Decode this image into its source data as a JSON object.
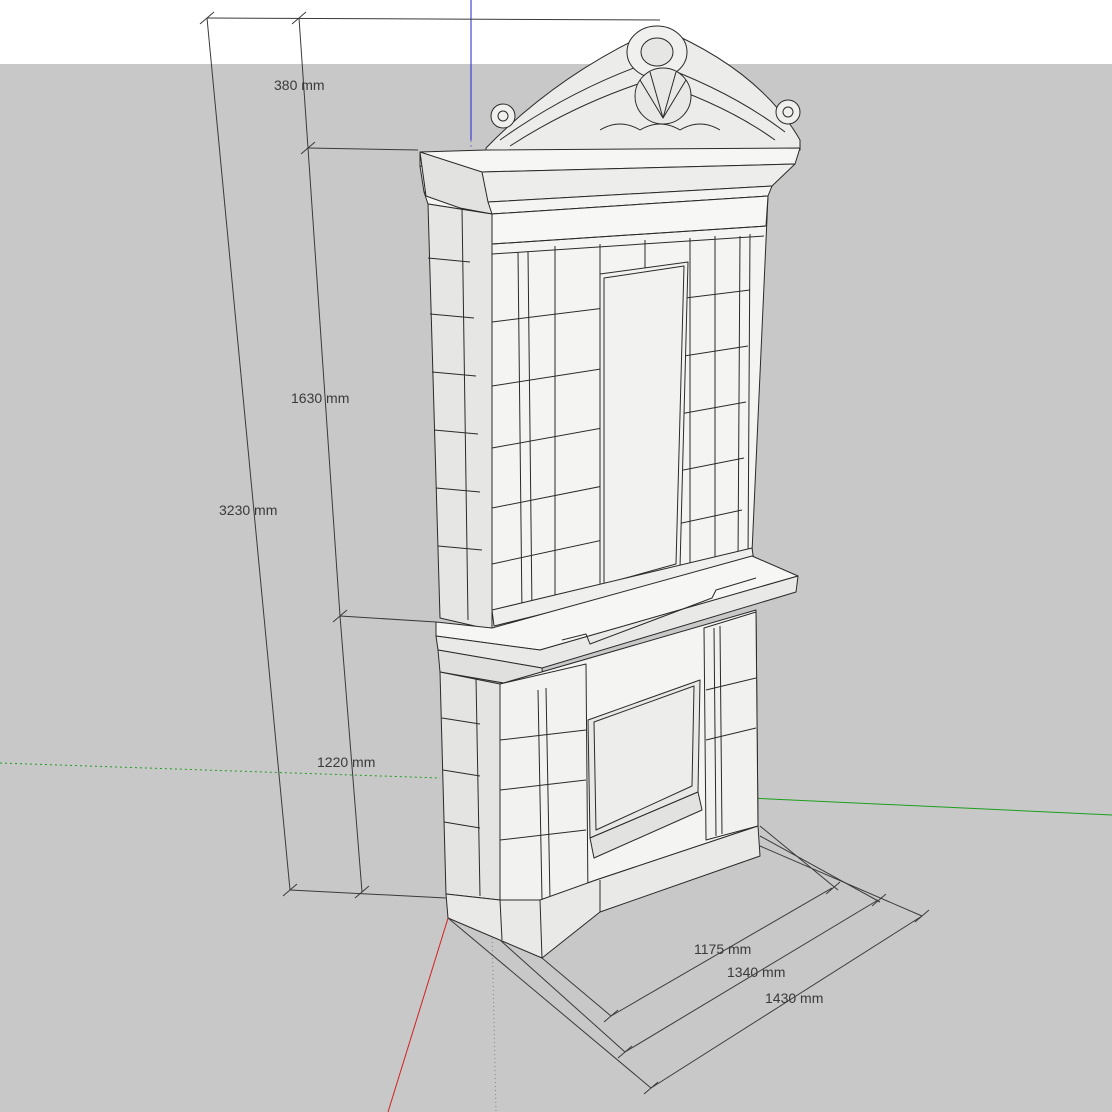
{
  "app": "SketchUp",
  "colors": {
    "sky": "#ffffff",
    "ground": "#c8c8c8",
    "model_face": "#f4f4f2",
    "model_shade": "#dcdcda",
    "model_edge": "#2a2a2a",
    "dimension_line": "#3a3a3a",
    "axis_red": "#d42020",
    "axis_green": "#1e9e1e",
    "axis_blue": "#2020d0"
  },
  "model": {
    "name": "fireplace-mantel"
  },
  "dimensions": {
    "overall_height": "3230 mm",
    "crest_height": "380 mm",
    "overmantel_height": "1630 mm",
    "firebox_height": "1220 mm",
    "depth_a": "1175 mm",
    "depth_b": "1340 mm",
    "depth_c": "1430 mm"
  }
}
